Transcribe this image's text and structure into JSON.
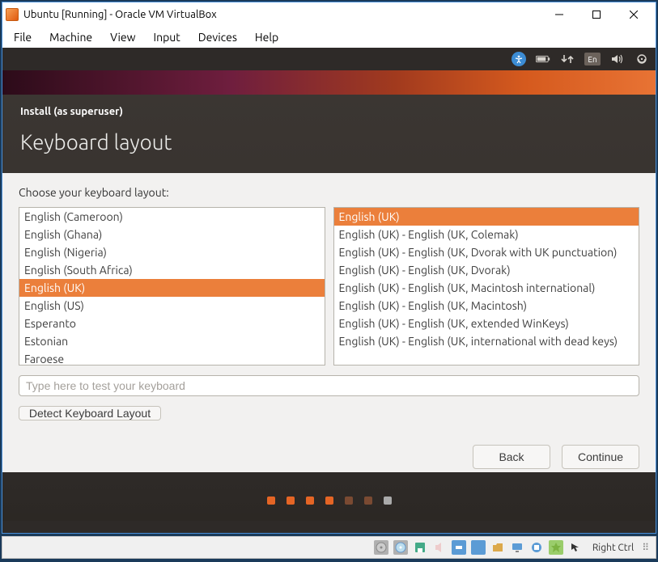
{
  "window": {
    "title": "Ubuntu [Running] - Oracle VM VirtualBox"
  },
  "menubar": [
    "File",
    "Machine",
    "View",
    "Input",
    "Devices",
    "Help"
  ],
  "guest_top_icons": {
    "a11y": "✱",
    "battery": "battery-icon",
    "network": "↑↓",
    "lang": "En",
    "sound": "🔊",
    "power": "⏻"
  },
  "installer": {
    "header": "Install (as superuser)",
    "title": "Keyboard layout",
    "prompt": "Choose your keyboard layout:",
    "layouts": [
      "English (Cameroon)",
      "English (Ghana)",
      "English (Nigeria)",
      "English (South Africa)",
      "English (UK)",
      "English (US)",
      "Esperanto",
      "Estonian",
      "Faroese"
    ],
    "layouts_selected_index": 4,
    "variants": [
      "English (UK)",
      "English (UK) - English (UK, Colemak)",
      "English (UK) - English (UK, Dvorak with UK punctuation)",
      "English (UK) - English (UK, Dvorak)",
      "English (UK) - English (UK, Macintosh international)",
      "English (UK) - English (UK, Macintosh)",
      "English (UK) - English (UK, extended WinKeys)",
      "English (UK) - English (UK, international with dead keys)"
    ],
    "variants_selected_index": 0,
    "test_placeholder": "Type here to test your keyboard",
    "detect_label": "Detect Keyboard Layout",
    "back_label": "Back",
    "continue_label": "Continue"
  },
  "vbox_status": {
    "host_key": "Right Ctrl"
  }
}
